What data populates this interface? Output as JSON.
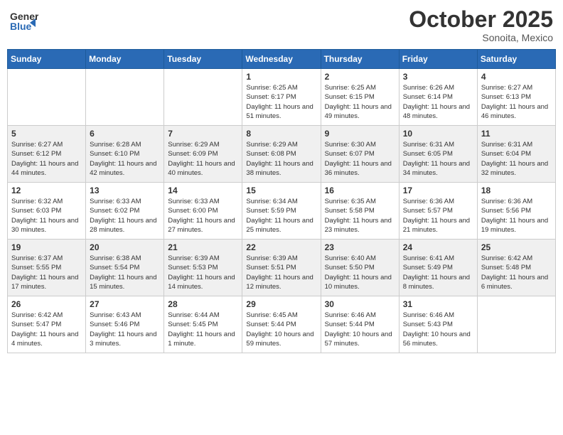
{
  "header": {
    "logo_general": "General",
    "logo_blue": "Blue",
    "month": "October 2025",
    "location": "Sonoita, Mexico"
  },
  "weekdays": [
    "Sunday",
    "Monday",
    "Tuesday",
    "Wednesday",
    "Thursday",
    "Friday",
    "Saturday"
  ],
  "weeks": [
    [
      {
        "day": "",
        "sunrise": "",
        "sunset": "",
        "daylight": ""
      },
      {
        "day": "",
        "sunrise": "",
        "sunset": "",
        "daylight": ""
      },
      {
        "day": "",
        "sunrise": "",
        "sunset": "",
        "daylight": ""
      },
      {
        "day": "1",
        "sunrise": "Sunrise: 6:25 AM",
        "sunset": "Sunset: 6:17 PM",
        "daylight": "Daylight: 11 hours and 51 minutes."
      },
      {
        "day": "2",
        "sunrise": "Sunrise: 6:25 AM",
        "sunset": "Sunset: 6:15 PM",
        "daylight": "Daylight: 11 hours and 49 minutes."
      },
      {
        "day": "3",
        "sunrise": "Sunrise: 6:26 AM",
        "sunset": "Sunset: 6:14 PM",
        "daylight": "Daylight: 11 hours and 48 minutes."
      },
      {
        "day": "4",
        "sunrise": "Sunrise: 6:27 AM",
        "sunset": "Sunset: 6:13 PM",
        "daylight": "Daylight: 11 hours and 46 minutes."
      }
    ],
    [
      {
        "day": "5",
        "sunrise": "Sunrise: 6:27 AM",
        "sunset": "Sunset: 6:12 PM",
        "daylight": "Daylight: 11 hours and 44 minutes."
      },
      {
        "day": "6",
        "sunrise": "Sunrise: 6:28 AM",
        "sunset": "Sunset: 6:10 PM",
        "daylight": "Daylight: 11 hours and 42 minutes."
      },
      {
        "day": "7",
        "sunrise": "Sunrise: 6:29 AM",
        "sunset": "Sunset: 6:09 PM",
        "daylight": "Daylight: 11 hours and 40 minutes."
      },
      {
        "day": "8",
        "sunrise": "Sunrise: 6:29 AM",
        "sunset": "Sunset: 6:08 PM",
        "daylight": "Daylight: 11 hours and 38 minutes."
      },
      {
        "day": "9",
        "sunrise": "Sunrise: 6:30 AM",
        "sunset": "Sunset: 6:07 PM",
        "daylight": "Daylight: 11 hours and 36 minutes."
      },
      {
        "day": "10",
        "sunrise": "Sunrise: 6:31 AM",
        "sunset": "Sunset: 6:05 PM",
        "daylight": "Daylight: 11 hours and 34 minutes."
      },
      {
        "day": "11",
        "sunrise": "Sunrise: 6:31 AM",
        "sunset": "Sunset: 6:04 PM",
        "daylight": "Daylight: 11 hours and 32 minutes."
      }
    ],
    [
      {
        "day": "12",
        "sunrise": "Sunrise: 6:32 AM",
        "sunset": "Sunset: 6:03 PM",
        "daylight": "Daylight: 11 hours and 30 minutes."
      },
      {
        "day": "13",
        "sunrise": "Sunrise: 6:33 AM",
        "sunset": "Sunset: 6:02 PM",
        "daylight": "Daylight: 11 hours and 28 minutes."
      },
      {
        "day": "14",
        "sunrise": "Sunrise: 6:33 AM",
        "sunset": "Sunset: 6:00 PM",
        "daylight": "Daylight: 11 hours and 27 minutes."
      },
      {
        "day": "15",
        "sunrise": "Sunrise: 6:34 AM",
        "sunset": "Sunset: 5:59 PM",
        "daylight": "Daylight: 11 hours and 25 minutes."
      },
      {
        "day": "16",
        "sunrise": "Sunrise: 6:35 AM",
        "sunset": "Sunset: 5:58 PM",
        "daylight": "Daylight: 11 hours and 23 minutes."
      },
      {
        "day": "17",
        "sunrise": "Sunrise: 6:36 AM",
        "sunset": "Sunset: 5:57 PM",
        "daylight": "Daylight: 11 hours and 21 minutes."
      },
      {
        "day": "18",
        "sunrise": "Sunrise: 6:36 AM",
        "sunset": "Sunset: 5:56 PM",
        "daylight": "Daylight: 11 hours and 19 minutes."
      }
    ],
    [
      {
        "day": "19",
        "sunrise": "Sunrise: 6:37 AM",
        "sunset": "Sunset: 5:55 PM",
        "daylight": "Daylight: 11 hours and 17 minutes."
      },
      {
        "day": "20",
        "sunrise": "Sunrise: 6:38 AM",
        "sunset": "Sunset: 5:54 PM",
        "daylight": "Daylight: 11 hours and 15 minutes."
      },
      {
        "day": "21",
        "sunrise": "Sunrise: 6:39 AM",
        "sunset": "Sunset: 5:53 PM",
        "daylight": "Daylight: 11 hours and 14 minutes."
      },
      {
        "day": "22",
        "sunrise": "Sunrise: 6:39 AM",
        "sunset": "Sunset: 5:51 PM",
        "daylight": "Daylight: 11 hours and 12 minutes."
      },
      {
        "day": "23",
        "sunrise": "Sunrise: 6:40 AM",
        "sunset": "Sunset: 5:50 PM",
        "daylight": "Daylight: 11 hours and 10 minutes."
      },
      {
        "day": "24",
        "sunrise": "Sunrise: 6:41 AM",
        "sunset": "Sunset: 5:49 PM",
        "daylight": "Daylight: 11 hours and 8 minutes."
      },
      {
        "day": "25",
        "sunrise": "Sunrise: 6:42 AM",
        "sunset": "Sunset: 5:48 PM",
        "daylight": "Daylight: 11 hours and 6 minutes."
      }
    ],
    [
      {
        "day": "26",
        "sunrise": "Sunrise: 6:42 AM",
        "sunset": "Sunset: 5:47 PM",
        "daylight": "Daylight: 11 hours and 4 minutes."
      },
      {
        "day": "27",
        "sunrise": "Sunrise: 6:43 AM",
        "sunset": "Sunset: 5:46 PM",
        "daylight": "Daylight: 11 hours and 3 minutes."
      },
      {
        "day": "28",
        "sunrise": "Sunrise: 6:44 AM",
        "sunset": "Sunset: 5:45 PM",
        "daylight": "Daylight: 11 hours and 1 minute."
      },
      {
        "day": "29",
        "sunrise": "Sunrise: 6:45 AM",
        "sunset": "Sunset: 5:44 PM",
        "daylight": "Daylight: 10 hours and 59 minutes."
      },
      {
        "day": "30",
        "sunrise": "Sunrise: 6:46 AM",
        "sunset": "Sunset: 5:44 PM",
        "daylight": "Daylight: 10 hours and 57 minutes."
      },
      {
        "day": "31",
        "sunrise": "Sunrise: 6:46 AM",
        "sunset": "Sunset: 5:43 PM",
        "daylight": "Daylight: 10 hours and 56 minutes."
      },
      {
        "day": "",
        "sunrise": "",
        "sunset": "",
        "daylight": ""
      }
    ]
  ]
}
